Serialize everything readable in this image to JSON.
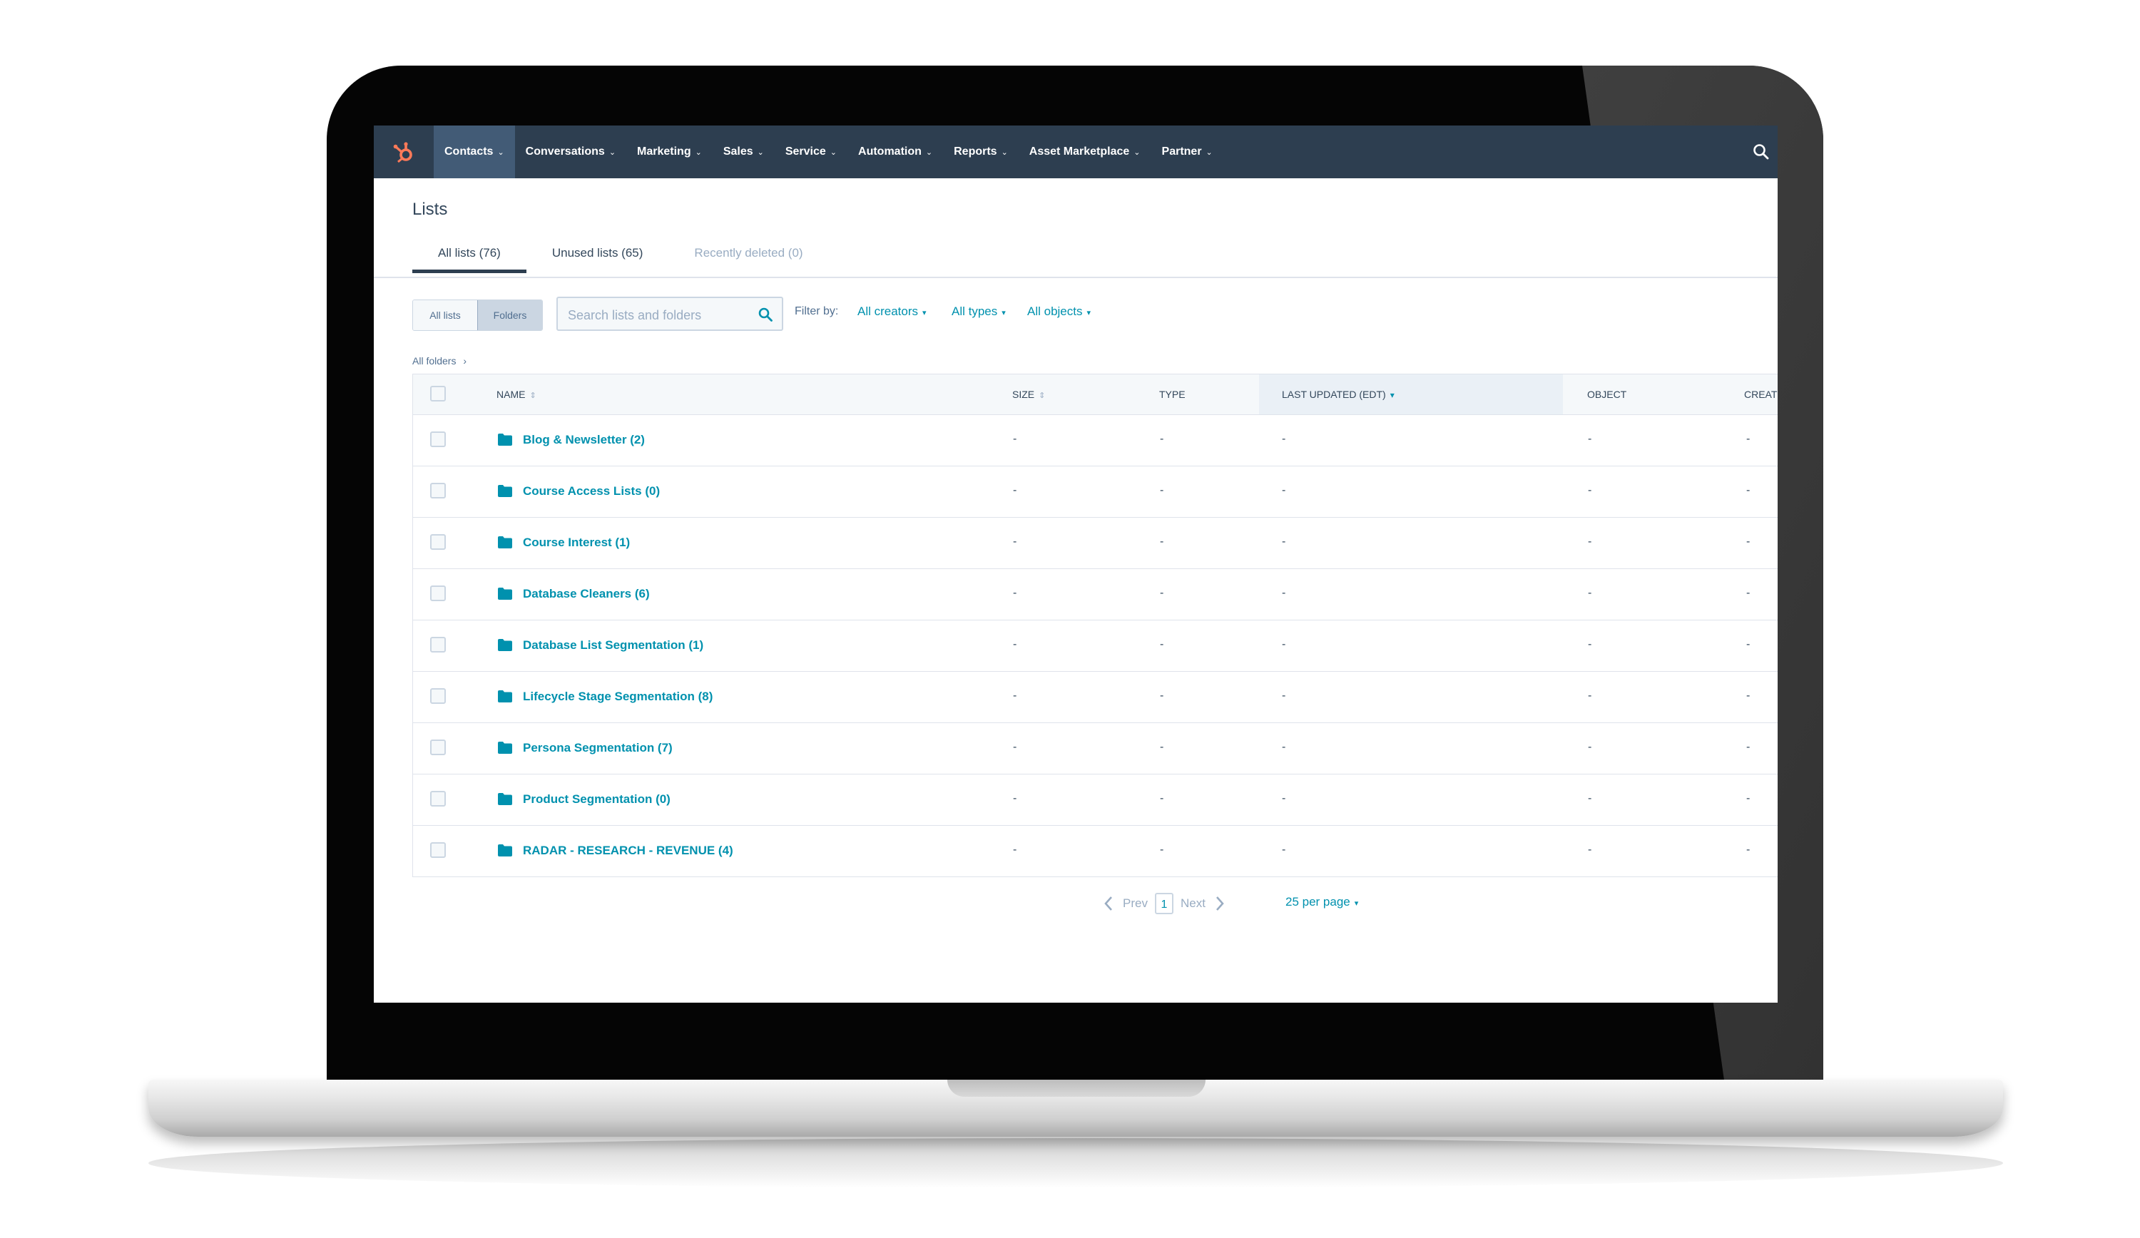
{
  "nav": {
    "items": [
      {
        "label": "Contacts",
        "active": true
      },
      {
        "label": "Conversations",
        "active": false
      },
      {
        "label": "Marketing",
        "active": false
      },
      {
        "label": "Sales",
        "active": false
      },
      {
        "label": "Service",
        "active": false
      },
      {
        "label": "Automation",
        "active": false
      },
      {
        "label": "Reports",
        "active": false
      },
      {
        "label": "Asset Marketplace",
        "active": false
      },
      {
        "label": "Partner",
        "active": false
      }
    ],
    "caret": "⌄",
    "logo_icon": "hubspot-sprocket-icon",
    "search_icon": "search-icon"
  },
  "page": {
    "title": "Lists"
  },
  "tabs": [
    {
      "label": "All lists (76)",
      "state": "active"
    },
    {
      "label": "Unused lists (65)",
      "state": "normal"
    },
    {
      "label": "Recently deleted (0)",
      "state": "muted"
    }
  ],
  "toolbar": {
    "view_toggle": [
      "All lists",
      "Folders"
    ],
    "selected_view": "Folders",
    "search_placeholder": "Search lists and folders",
    "filter_label": "Filter by:",
    "filters": [
      "All creators",
      "All types",
      "All objects"
    ],
    "dropdown_caret": "▾"
  },
  "breadcrumb": {
    "label": "All folders",
    "separator": "›"
  },
  "table": {
    "columns": [
      {
        "label": "NAME",
        "sortable": true
      },
      {
        "label": "SIZE",
        "sortable": true
      },
      {
        "label": "TYPE",
        "sortable": false
      },
      {
        "label": "LAST UPDATED (EDT)",
        "sortable": true,
        "sorted": "desc"
      },
      {
        "label": "OBJECT",
        "sortable": false
      },
      {
        "label": "CREAT",
        "sortable": false
      }
    ],
    "sort_glyph": "⇕",
    "sort_active_glyph": "▾",
    "empty_value": "-",
    "rows": [
      {
        "name": "Blog & Newsletter (2)"
      },
      {
        "name": "Course Access Lists (0)"
      },
      {
        "name": "Course Interest (1)"
      },
      {
        "name": "Database Cleaners (6)"
      },
      {
        "name": "Database List Segmentation (1)"
      },
      {
        "name": "Lifecycle Stage Segmentation (8)"
      },
      {
        "name": "Persona Segmentation (7)"
      },
      {
        "name": "Product Segmentation (0)"
      },
      {
        "name": "RADAR - RESEARCH - REVENUE (4)"
      }
    ]
  },
  "pagination": {
    "prev": "Prev",
    "current_page": "1",
    "next": "Next",
    "per_page": "25 per page"
  },
  "colors": {
    "nav_bg": "#2d3e50",
    "nav_active": "#425b76",
    "link": "#0091ae",
    "text": "#33475b",
    "logo": "#ff7a59"
  }
}
